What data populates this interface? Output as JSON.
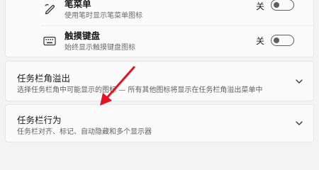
{
  "pen_menu": {
    "title": "笔菜单",
    "description": "使用笔时显示笔菜单图标",
    "state_label": "关",
    "toggle_on": false,
    "icon": "pen-icon"
  },
  "touch_keyboard": {
    "title": "触摸键盘",
    "description": "始终显示触摸键盘图标",
    "state_label": "关",
    "toggle_on": false,
    "icon": "keyboard-icon"
  },
  "taskbar_corner_overflow": {
    "title": "任务栏角溢出",
    "description": "选择任务栏角中可能显示的图标 — 所有其他图标将显示在任务栏角溢出菜单中",
    "icon": "chevron-down-icon"
  },
  "taskbar_behaviors": {
    "title": "任务栏行为",
    "description": "任务栏对齐、标记、自动隐藏和多个显示器",
    "icon": "chevron-down-icon"
  },
  "colors": {
    "annotation_arrow": "#e81123",
    "toggle_off": "#5e5e5e",
    "card_background": "#fbfbfb",
    "page_background": "#f3f3f3"
  }
}
